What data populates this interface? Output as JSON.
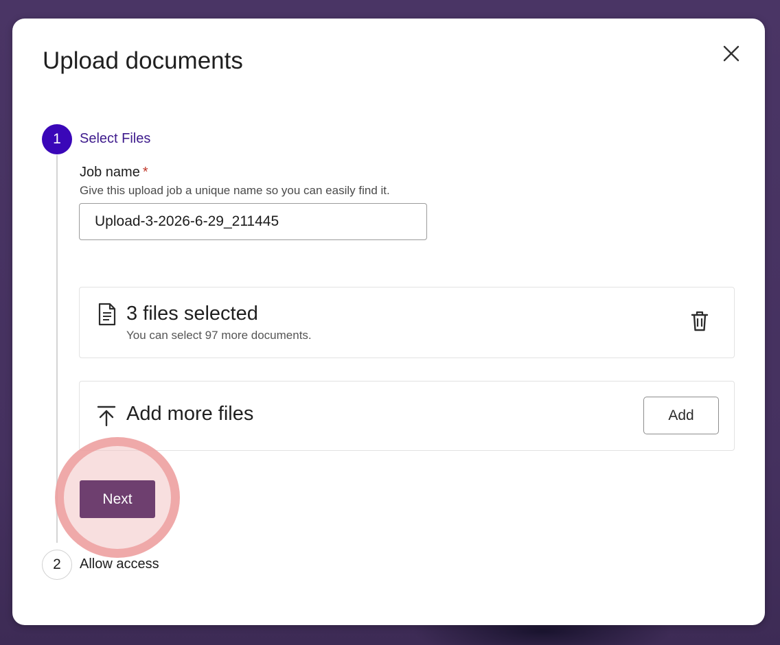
{
  "dialog": {
    "title": "Upload documents"
  },
  "steps": [
    {
      "number": "1",
      "label": "Select Files",
      "state": "active"
    },
    {
      "number": "2",
      "label": "Allow access",
      "state": "pending"
    }
  ],
  "job_name": {
    "label": "Job name",
    "required_marker": "*",
    "help": "Give this upload job a unique name so you can easily find it.",
    "value": "Upload-3-2026-6-29_211445"
  },
  "selected_files": {
    "title": "3 files selected",
    "subtitle": "You can select 97 more documents.",
    "icon": "document-icon",
    "action_icon": "trash-icon"
  },
  "add_files": {
    "title": "Add more files",
    "icon": "upload-icon",
    "button_label": "Add"
  },
  "next_button": {
    "label": "Next"
  },
  "colors": {
    "backdrop": "#4a3565",
    "active_step": "#3a07b8",
    "active_step_label": "#3d1a8c",
    "primary_button": "#6e3f6f",
    "highlight": "#ec9797",
    "required": "#c0392b"
  }
}
